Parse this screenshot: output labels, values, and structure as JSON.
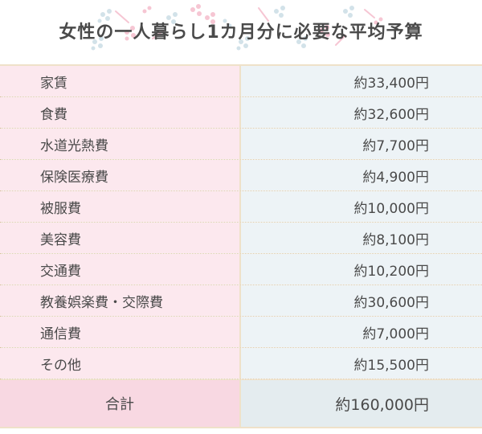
{
  "title": "女性の一人暮らし1カ月分に必要な平均予算",
  "colors": {
    "label_bg": "#fce8ee",
    "value_bg": "#edf3f6",
    "total_label_bg": "#f8d8e2",
    "total_value_bg": "#e4ecef",
    "border": "#efe1c9",
    "text": "#4a4a4a"
  },
  "rows": [
    {
      "label": "家賃",
      "value": "約33,400円"
    },
    {
      "label": "食費",
      "value": "約32,600円"
    },
    {
      "label": "水道光熱費",
      "value": "約7,700円"
    },
    {
      "label": "保険医療費",
      "value": "約4,900円"
    },
    {
      "label": "被服費",
      "value": "約10,000円"
    },
    {
      "label": "美容費",
      "value": "約8,100円"
    },
    {
      "label": "交通費",
      "value": "約10,200円"
    },
    {
      "label": "教養娯楽費・交際費",
      "value": "約30,600円"
    },
    {
      "label": "通信費",
      "value": "約7,000円"
    },
    {
      "label": "その他",
      "value": "約15,500円"
    }
  ],
  "total": {
    "label": "合計",
    "value": "約160,000円"
  }
}
